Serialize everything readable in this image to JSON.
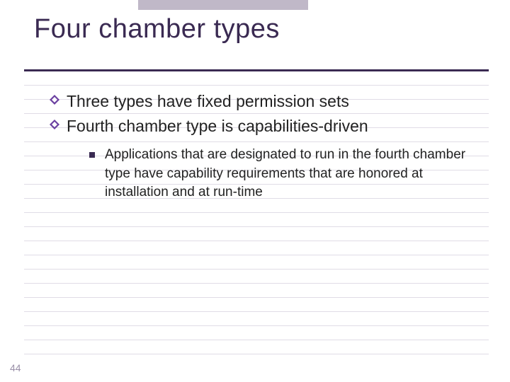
{
  "page_number": "44",
  "title": "Four chamber types",
  "bullets": [
    {
      "text": "Three types have fixed permission sets"
    },
    {
      "text": "Fourth chamber type is capabilities-driven"
    }
  ],
  "sub_bullet": "Applications that are designated to run in the fourth chamber type have capability requirements that are honored at installation and at run-time"
}
